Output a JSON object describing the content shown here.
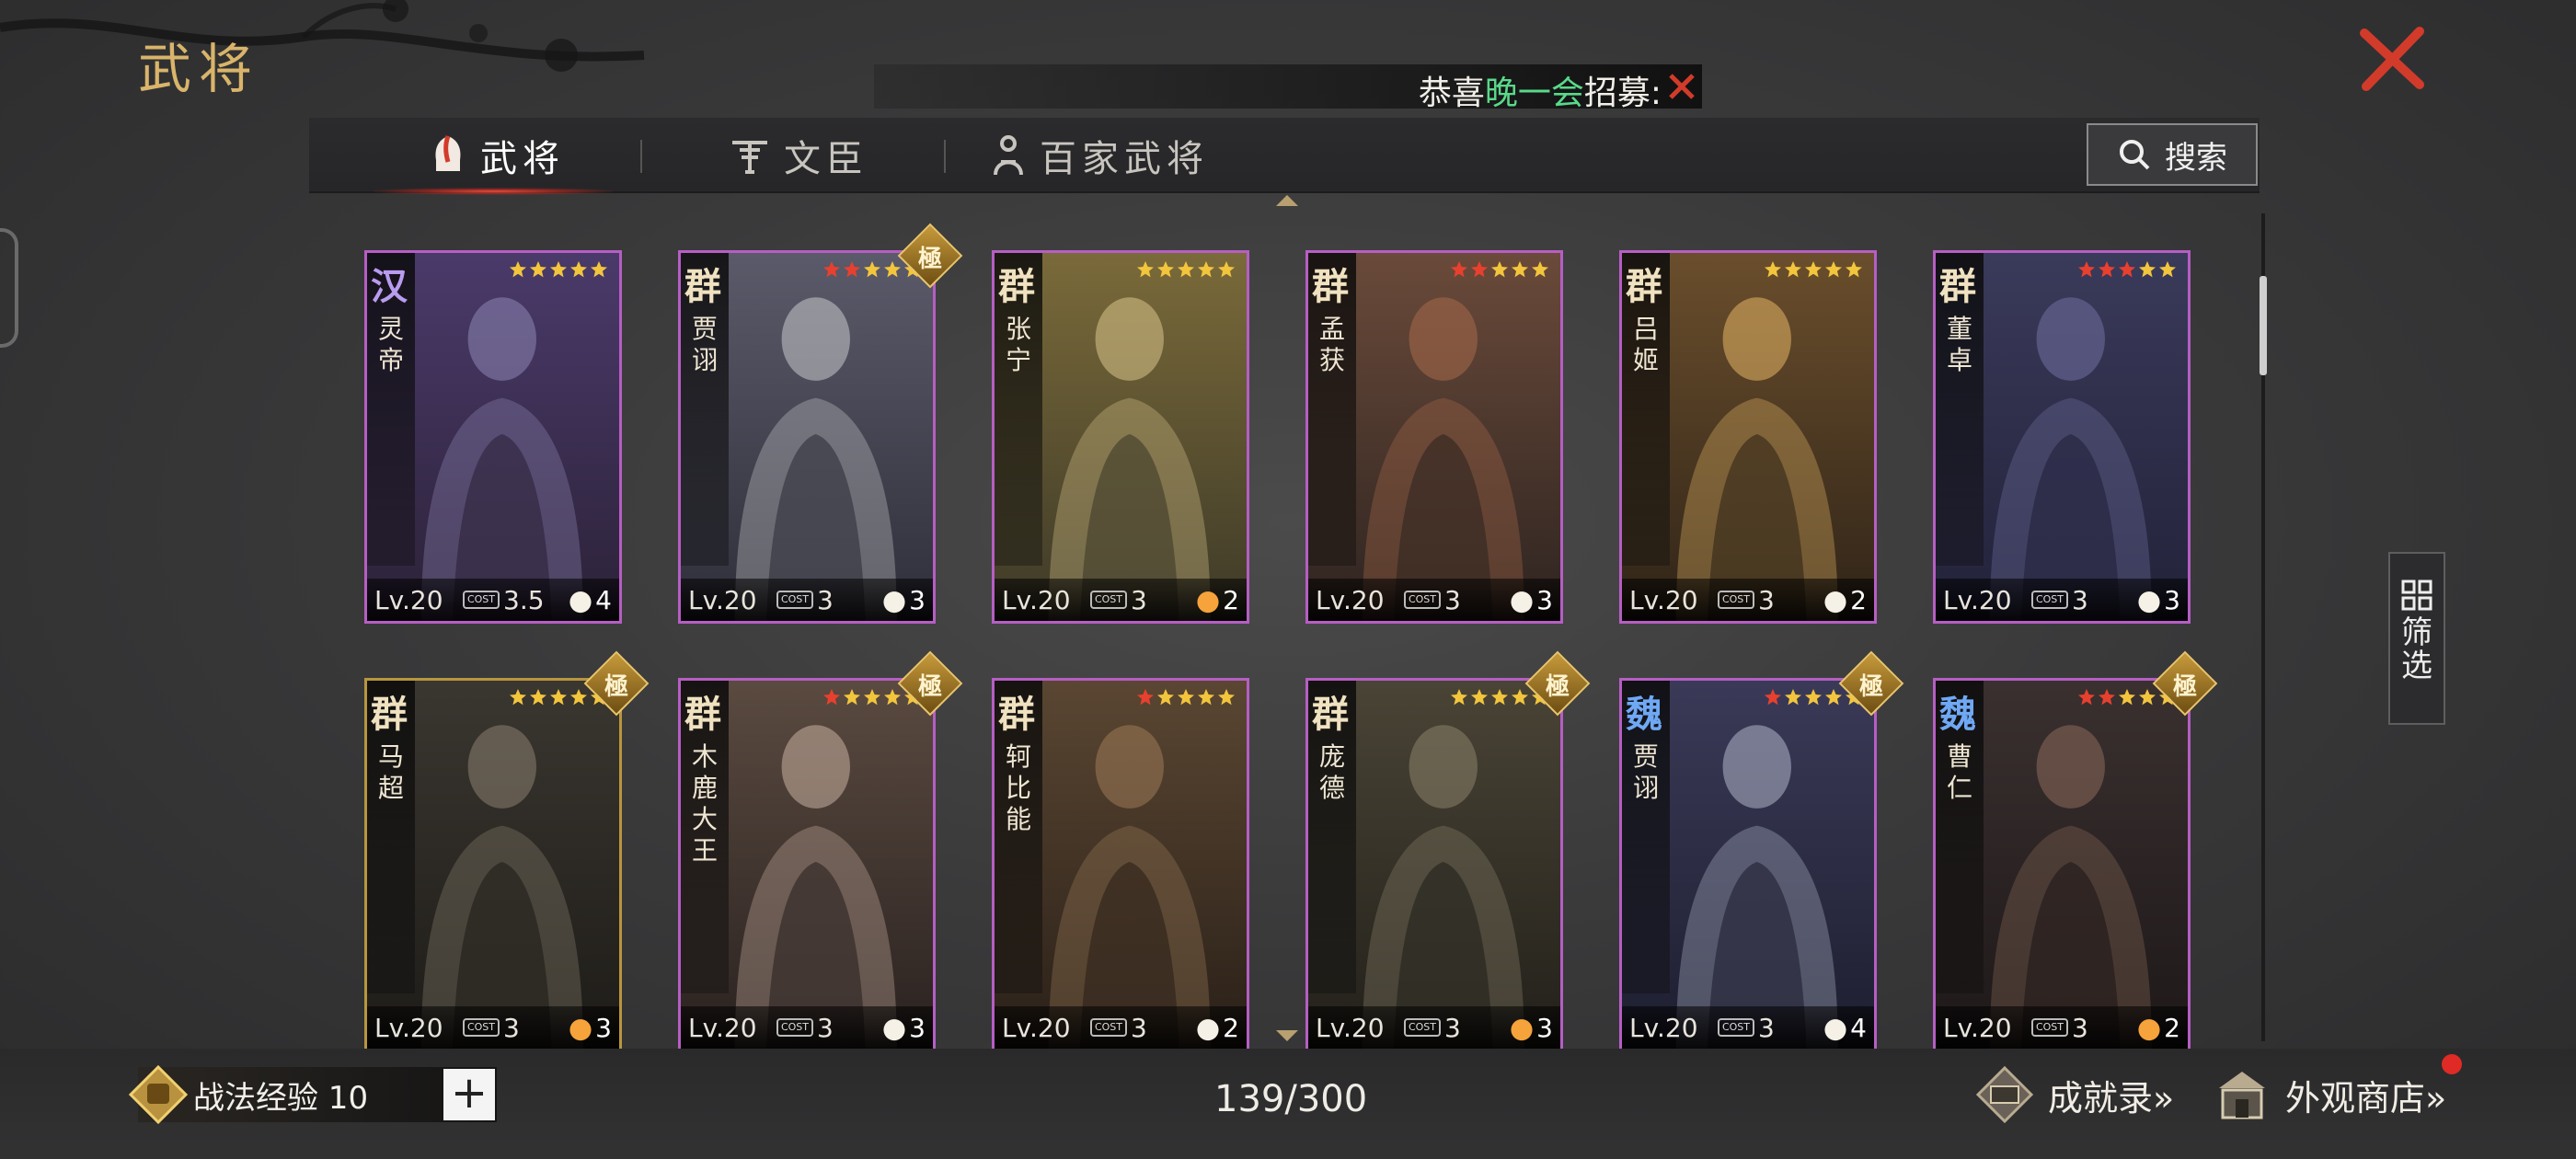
{
  "header": {
    "title": "武将",
    "notice_prefix": "恭喜",
    "notice_highlight": "晚一会",
    "notice_suffix": "招募:"
  },
  "tabs": [
    {
      "label": "武将",
      "icon": "helmet-icon",
      "active": true
    },
    {
      "label": "文臣",
      "icon": "scholar-icon",
      "active": false
    },
    {
      "label": "百家武将",
      "icon": "sage-icon",
      "active": false
    }
  ],
  "search": {
    "label": "搜索"
  },
  "filter": {
    "label": "筛选"
  },
  "cards": [
    {
      "faction": "汉",
      "name": "灵帝",
      "stars_red": 0,
      "extreme": false,
      "level": "Lv.20",
      "cost": "3.5",
      "troop": "4",
      "troop_icon": "bow-icon",
      "colors": [
        "#4a3a6a",
        "#8e86b4",
        "#2c2238"
      ]
    },
    {
      "faction": "群",
      "name": "贾诩",
      "stars_red": 2,
      "extreme": true,
      "level": "Lv.20",
      "cost": "3",
      "troop": "3",
      "troop_icon": "shield-icon",
      "colors": [
        "#5a5a6a",
        "#c9c8cc",
        "#2f2f3a"
      ]
    },
    {
      "faction": "群",
      "name": "张宁",
      "stars_red": 0,
      "extreme": false,
      "level": "Lv.20",
      "cost": "3",
      "troop": "2",
      "troop_icon": "fire-icon",
      "colors": [
        "#7a6a3a",
        "#d8c48a",
        "#3e3a28"
      ]
    },
    {
      "faction": "群",
      "name": "孟获",
      "stars_red": 2,
      "extreme": false,
      "level": "Lv.20",
      "cost": "3",
      "troop": "3",
      "troop_icon": "shield-icon",
      "colors": [
        "#6a4a3a",
        "#a86a4a",
        "#2e2420"
      ]
    },
    {
      "faction": "群",
      "name": "吕姬",
      "stars_red": 0,
      "extreme": false,
      "level": "Lv.20",
      "cost": "3",
      "troop": "2",
      "troop_icon": "shield-icon",
      "colors": [
        "#6a4e2c",
        "#e3b464",
        "#302418"
      ]
    },
    {
      "faction": "群",
      "name": "董卓",
      "stars_red": 3,
      "extreme": false,
      "level": "Lv.20",
      "cost": "3",
      "troop": "3",
      "troop_icon": "horse-icon",
      "colors": [
        "#3a3a5a",
        "#7070a0",
        "#22223a"
      ]
    },
    {
      "faction": "群",
      "name": "马超",
      "stars_red": 0,
      "extreme": true,
      "gold": true,
      "level": "Lv.20",
      "cost": "3",
      "troop": "3",
      "troop_icon": "fire-icon",
      "colors": [
        "#3a3630",
        "#8a8070",
        "#1e1c18"
      ]
    },
    {
      "faction": "群",
      "name": "木鹿大王",
      "stars_red": 1,
      "extreme": true,
      "level": "Lv.20",
      "cost": "3",
      "troop": "3",
      "troop_icon": "horse-icon",
      "colors": [
        "#5a4a40",
        "#c8b0a0",
        "#2a2220"
      ]
    },
    {
      "faction": "群",
      "name": "轲比能",
      "stars_red": 1,
      "extreme": false,
      "level": "Lv.20",
      "cost": "3",
      "troop": "2",
      "troop_icon": "horse-icon",
      "colors": [
        "#5a4632",
        "#9c7a58",
        "#2a2018"
      ]
    },
    {
      "faction": "群",
      "name": "庞德",
      "stars_red": 0,
      "extreme": true,
      "level": "Lv.20",
      "cost": "3",
      "troop": "3",
      "troop_icon": "fire-icon",
      "colors": [
        "#4a4436",
        "#8a826a",
        "#22201a"
      ]
    },
    {
      "faction": "魏",
      "name": "贾诩",
      "stars_red": 1,
      "extreme": true,
      "level": "Lv.20",
      "cost": "3",
      "troop": "4",
      "troop_icon": "bow-icon",
      "colors": [
        "#3a3a58",
        "#b0b4c8",
        "#1e1e30"
      ]
    },
    {
      "faction": "魏",
      "name": "曹仁",
      "stars_red": 2,
      "extreme": true,
      "level": "Lv.20",
      "cost": "3",
      "troop": "2",
      "troop_icon": "fire-icon",
      "colors": [
        "#3a3030",
        "#8a6a5a",
        "#1e1818"
      ]
    }
  ],
  "cost_label": "COST",
  "footer": {
    "exp_label": "战法经验 10",
    "plus": "+",
    "count": "139/300",
    "achievements": "成就录»",
    "shop": "外观商店»"
  },
  "colors": {
    "accent_gold": "#d9b46a",
    "card_border": "#b65ec4",
    "close_red": "#d23b2a"
  }
}
